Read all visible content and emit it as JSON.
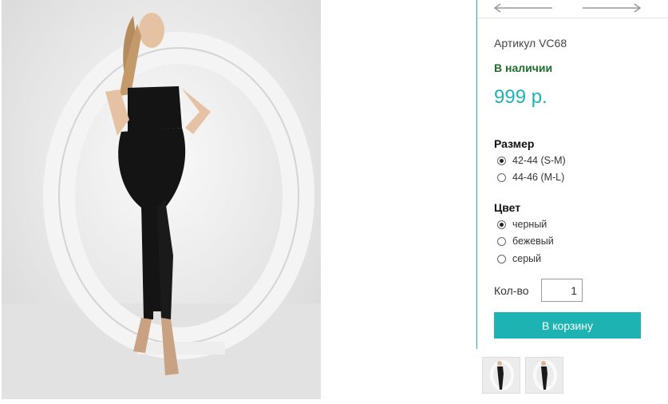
{
  "product": {
    "sku": "Артикул VC68",
    "stock": "В наличии",
    "price": "999 р."
  },
  "size": {
    "title": "Размер",
    "options": [
      {
        "label": "42-44 (S-M)",
        "checked": true
      },
      {
        "label": "44-46 (M-L)",
        "checked": false
      }
    ]
  },
  "color": {
    "title": "Цвет",
    "options": [
      {
        "label": "черный",
        "checked": true
      },
      {
        "label": "бежевый",
        "checked": false
      },
      {
        "label": "серый",
        "checked": false
      }
    ]
  },
  "quantity": {
    "label": "Кол-во",
    "value": "1"
  },
  "cart": {
    "button_label": "В корзину"
  },
  "nav": {
    "prev_icon": "arrow-left-icon",
    "next_icon": "arrow-right-icon"
  },
  "colors": {
    "accent": "#1db3b3",
    "stock_green": "#1e6e2a"
  }
}
